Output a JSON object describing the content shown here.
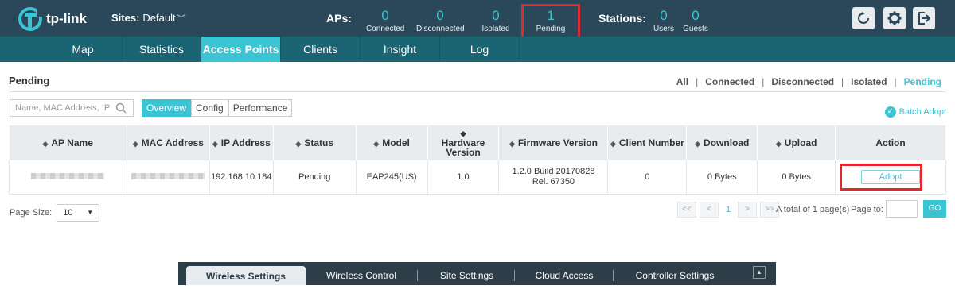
{
  "header": {
    "brand": "tp-link",
    "sites_label": "Sites:",
    "sites_value": "Default",
    "aps_label": "APs:",
    "aps": [
      {
        "value": "0",
        "label": "Connected"
      },
      {
        "value": "0",
        "label": "Disconnected"
      },
      {
        "value": "0",
        "label": "Isolated"
      },
      {
        "value": "1",
        "label": "Pending"
      }
    ],
    "stations_label": "Stations:",
    "stations": [
      {
        "value": "0",
        "label": "Users"
      },
      {
        "value": "0",
        "label": "Guests"
      }
    ],
    "icons": [
      "refresh-icon",
      "gear-icon",
      "logout-icon"
    ]
  },
  "nav": {
    "items": [
      "Map",
      "Statistics",
      "Access Points",
      "Clients",
      "Insight",
      "Log"
    ],
    "active": "Access Points"
  },
  "page": {
    "title": "Pending",
    "filters": [
      "All",
      "Connected",
      "Disconnected",
      "Isolated",
      "Pending"
    ],
    "active_filter": "Pending",
    "search_placeholder": "Name, MAC Address, IP",
    "view_tabs": [
      "Overview",
      "Config",
      "Performance"
    ],
    "active_view_tab": "Overview",
    "batch_adopt": "Batch Adopt"
  },
  "table": {
    "columns": [
      "AP Name",
      "MAC Address",
      "IP Address",
      "Status",
      "Model",
      "Hardware Version",
      "Firmware Version",
      "Client Number",
      "Download",
      "Upload",
      "Action"
    ],
    "rows": [
      {
        "ip": "192.168.10.184",
        "status": "Pending",
        "model": "EAP245(US)",
        "hardware": "1.0",
        "firmware": "1.2.0 Build 20170828 Rel. 67350",
        "clients": "0",
        "download": "0 Bytes",
        "upload": "0 Bytes",
        "action": "Adopt"
      }
    ]
  },
  "pagination": {
    "page_size_label": "Page Size:",
    "page_size": "10",
    "first": "<<",
    "prev": "<",
    "current": "1",
    "next": ">",
    "last": ">>",
    "total": "A total of 1 page(s)",
    "page_to": "Page to:",
    "go": "GO"
  },
  "bottom_bar": {
    "items": [
      "Wireless Settings",
      "Wireless Control",
      "Site Settings",
      "Cloud Access",
      "Controller Settings"
    ],
    "active": "Wireless Settings"
  },
  "colors": {
    "accent": "#3bc4d4",
    "topbar": "#2a4859",
    "navbar": "#1b6474",
    "highlight": "#e0282e"
  }
}
